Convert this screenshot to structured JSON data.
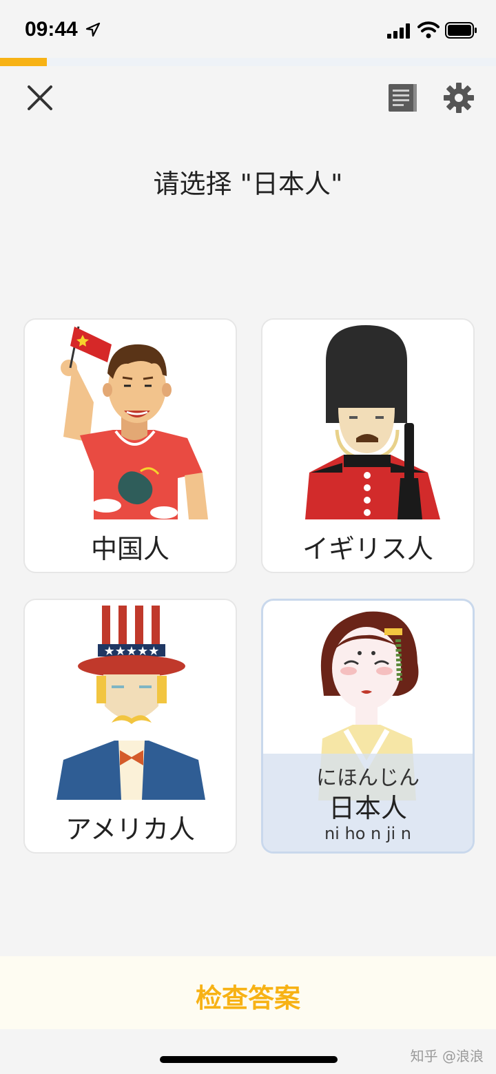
{
  "status_bar": {
    "time": "09:44"
  },
  "progress": {
    "fraction": 0.095
  },
  "toolbar": {
    "close_icon": "close-icon",
    "book_icon": "notebook-icon",
    "settings_icon": "gear-icon"
  },
  "question": "请选择 \"日本人\"",
  "options": [
    {
      "label": "中国人",
      "art": "chinese-person-illustration"
    },
    {
      "label": "イギリス人",
      "art": "british-guard-illustration"
    },
    {
      "label": "アメリカ人",
      "art": "uncle-sam-illustration"
    },
    {
      "kana": "にほんじん",
      "kanji": "日本人",
      "romaji": "ni ho n ji n",
      "art": "geisha-illustration",
      "selected": true
    }
  ],
  "check_button": "检查答案",
  "watermark": "知乎 @浪浪",
  "colors": {
    "accent": "#f7b215",
    "selected_overlay": "#d6e0f0",
    "background": "#f4f4f4"
  }
}
